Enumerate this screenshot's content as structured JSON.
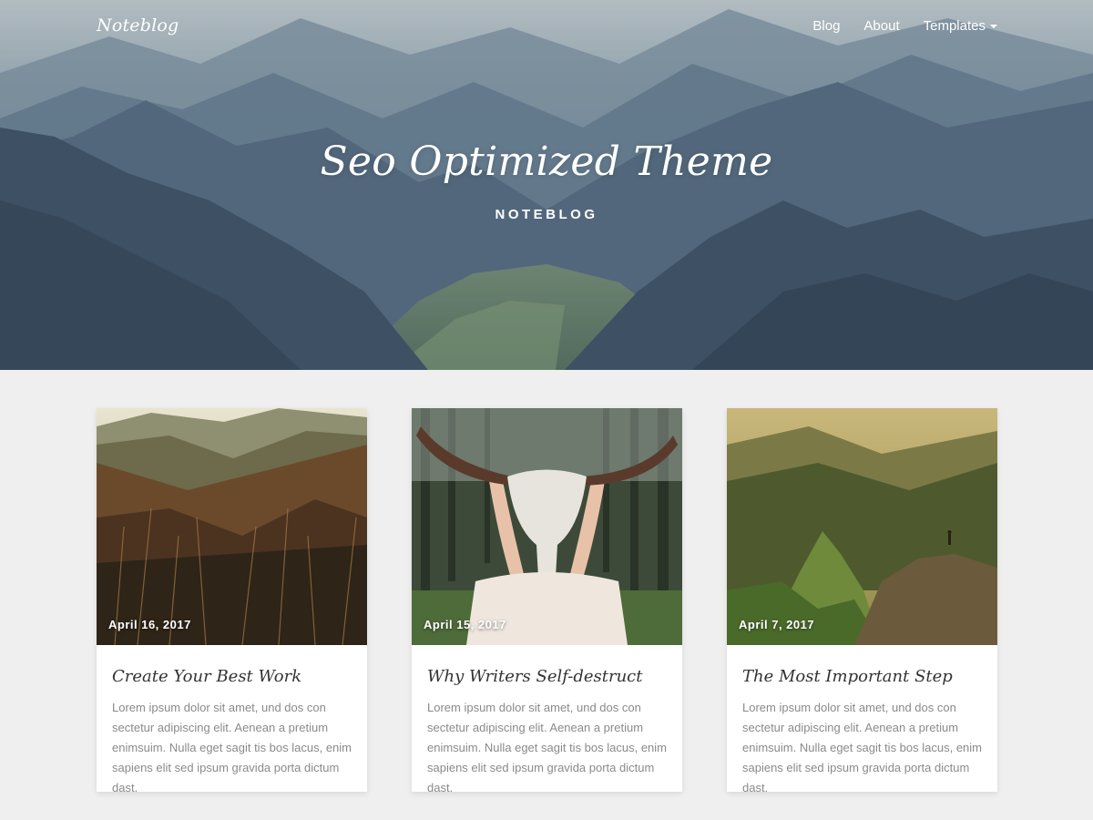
{
  "nav": {
    "brand": "Noteblog",
    "items": [
      {
        "label": "Blog"
      },
      {
        "label": "About"
      },
      {
        "label": "Templates"
      }
    ]
  },
  "hero": {
    "title": "Seo Optimized Theme",
    "subtitle": "NOTEBLOG"
  },
  "posts": [
    {
      "date": "April 16, 2017",
      "title": "Create Your Best Work",
      "excerpt": "Lorem ipsum dolor sit amet, und dos con sectetur adipiscing elit. Aenean a pretium enimsuim. Nulla eget sagit tis bos lacus, enim sapiens elit sed ipsum gravida porta dictum dast."
    },
    {
      "date": "April 15, 2017",
      "title": "Why Writers Self-destruct",
      "excerpt": "Lorem ipsum dolor sit amet, und dos con sectetur adipiscing elit. Aenean a pretium enimsuim. Nulla eget sagit tis bos lacus, enim sapiens elit sed ipsum gravida porta dictum dast."
    },
    {
      "date": "April 7, 2017",
      "title": "The Most Important Step",
      "excerpt": "Lorem ipsum dolor sit amet, und dos con sectetur adipiscing elit. Aenean a pretium enimsuim. Nulla eget sagit tis bos lacus, enim sapiens elit sed ipsum gravida porta dictum dast."
    }
  ],
  "colors": {
    "page_background": "#efefef",
    "card_background": "#ffffff",
    "title_text": "#333333",
    "excerpt_text": "#8a8a8a"
  },
  "icons": {
    "templates_dropdown": "caret-down-icon"
  }
}
